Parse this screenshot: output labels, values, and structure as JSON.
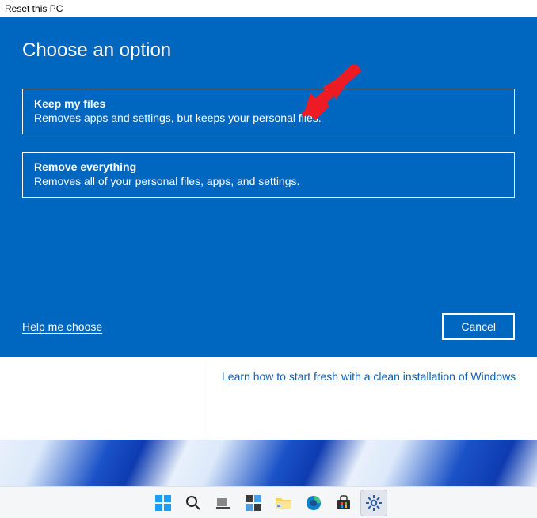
{
  "window": {
    "title": "Reset this PC"
  },
  "dialog": {
    "heading": "Choose an option",
    "options": [
      {
        "title": "Keep my files",
        "description": "Removes apps and settings, but keeps your personal files."
      },
      {
        "title": "Remove everything",
        "description": "Removes all of your personal files, apps, and settings."
      }
    ],
    "help_link": "Help me choose",
    "cancel_label": "Cancel"
  },
  "behind": {
    "fresh_link": "Learn how to start fresh with a clean installation of Windows"
  },
  "taskbar": {
    "items": [
      {
        "name": "start-icon"
      },
      {
        "name": "search-icon"
      },
      {
        "name": "task-view-icon"
      },
      {
        "name": "widgets-icon"
      },
      {
        "name": "file-explorer-icon"
      },
      {
        "name": "edge-icon"
      },
      {
        "name": "store-icon"
      },
      {
        "name": "settings-icon"
      }
    ]
  },
  "colors": {
    "dialog_bg": "#0067c0",
    "link_blue": "#0a5fb8",
    "arrow_red": "#ed1c24"
  }
}
